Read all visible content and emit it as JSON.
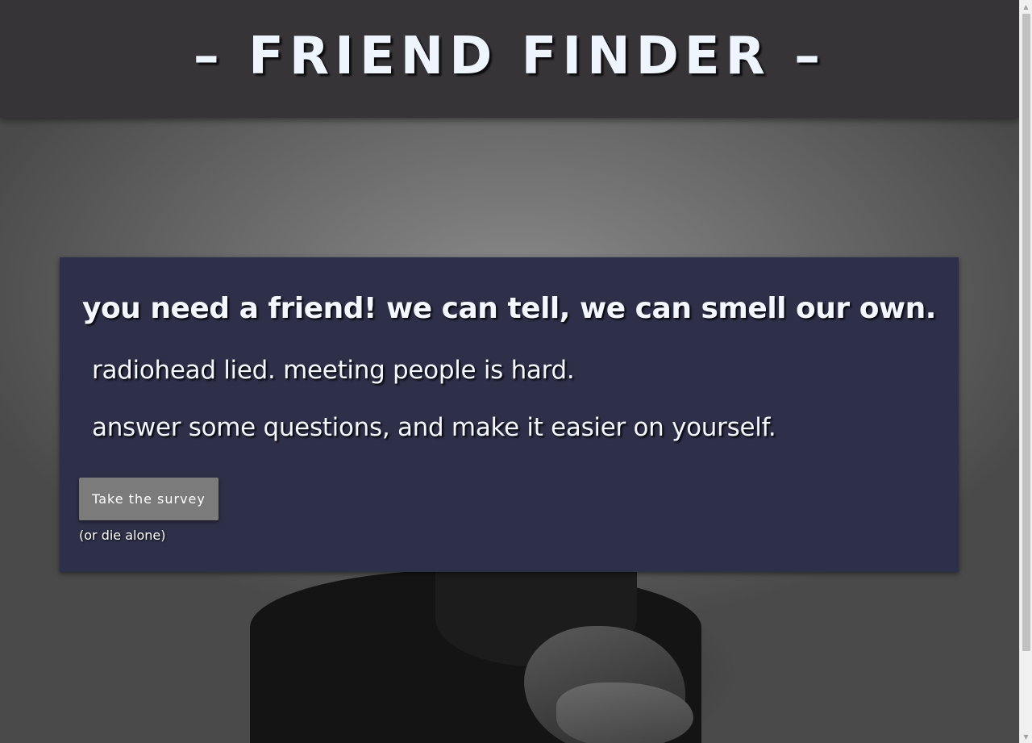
{
  "header": {
    "title": "– FRIEND FINDER –"
  },
  "hero": {
    "headline": "you need a friend! we can tell, we can smell our own.",
    "line_1": "radiohead lied. meeting people is hard.",
    "line_2": "answer some questions, and make it easier on yourself.",
    "button_label": "Take the survey",
    "subtext": "(or die alone)"
  },
  "scrollbar": {
    "up_icon": "triangle-up",
    "down_icon": "triangle-down"
  },
  "colors": {
    "header_bg": "#373437",
    "card_bg": "#2e2f48",
    "button_bg": "#7b7b7b",
    "text": "#f4f7ff"
  }
}
